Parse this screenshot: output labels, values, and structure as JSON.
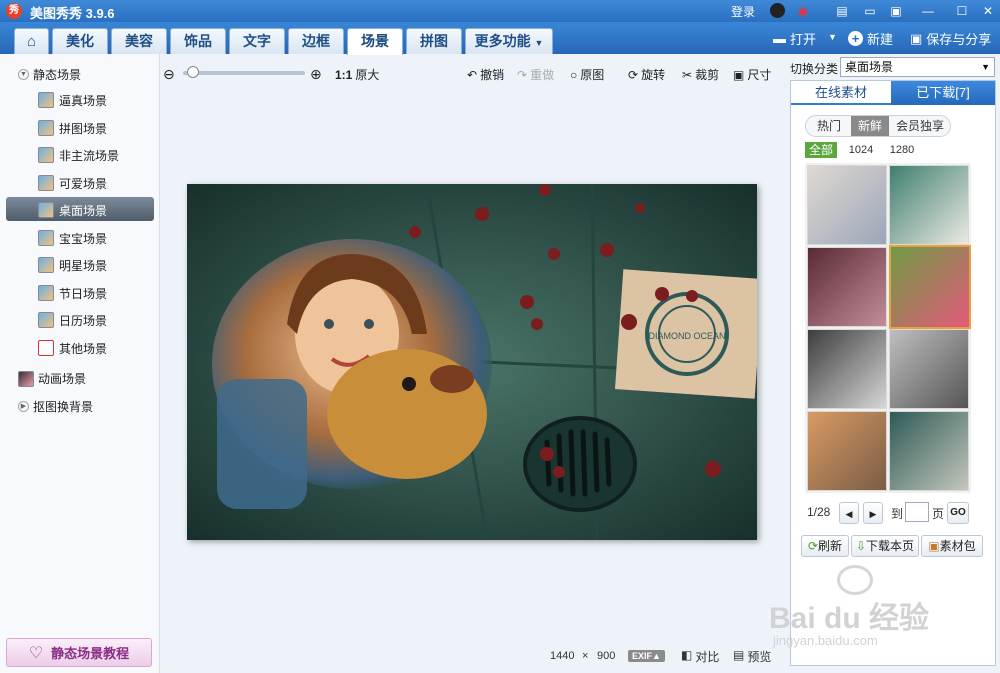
{
  "titlebar": {
    "logo": "秀",
    "title": "美图秀秀 3.9.6",
    "login": "登录",
    "icons": [
      "qq-icon",
      "weibo-icon",
      "menu-icon",
      "message-icon",
      "feedback-icon",
      "minimize-icon",
      "maximize-icon",
      "close-icon"
    ]
  },
  "tabs": [
    "美化",
    "美容",
    "饰品",
    "文字",
    "边框",
    "场景",
    "拼图",
    "更多功能"
  ],
  "active_tab": "场景",
  "top_actions": {
    "open": "打开",
    "new": "新建",
    "save_share": "保存与分享"
  },
  "sidebar": {
    "static_group": "静态场景",
    "items": [
      "逼真场景",
      "拼图场景",
      "非主流场景",
      "可爱场景",
      "桌面场景",
      "宝宝场景",
      "明星场景",
      "节日场景",
      "日历场景",
      "其他场景"
    ],
    "active_item": "桌面场景",
    "animated_group": "动画场景",
    "cutout_group": "抠图换背景",
    "tutorial_button": "静态场景教程"
  },
  "toolbar": {
    "ratio": "1:1",
    "original_size": "原大",
    "undo": "撤销",
    "redo": "重做",
    "original": "原图",
    "rotate": "旋转",
    "crop": "裁剪",
    "size": "尺寸",
    "zoom_level": 0.04
  },
  "right_panel": {
    "category_label": "切换分类",
    "category_value": "桌面场景",
    "tab_online": "在线素材",
    "tab_downloaded": "已下载",
    "downloaded_count": "[7]",
    "filters": [
      "热门",
      "新鲜",
      "会员独享"
    ],
    "active_filter": "新鲜",
    "resolutions": [
      "全部",
      "1024",
      "1280"
    ],
    "pager": {
      "current": "1/28",
      "goto": "到",
      "page": "页",
      "go": "GO"
    },
    "buttons": {
      "refresh": "刷新",
      "download_page": "下载本页",
      "material_pack": "素材包"
    }
  },
  "status": {
    "width": "1440",
    "times": "×",
    "height": "900",
    "exif": "EXIF▲",
    "compare": "对比",
    "preview": "预览"
  },
  "canvas": {
    "stamp_text": "DIAMOND OCEAN"
  },
  "watermark": {
    "brand": "Bai du 经验",
    "url": "jingyan.baidu.com"
  }
}
